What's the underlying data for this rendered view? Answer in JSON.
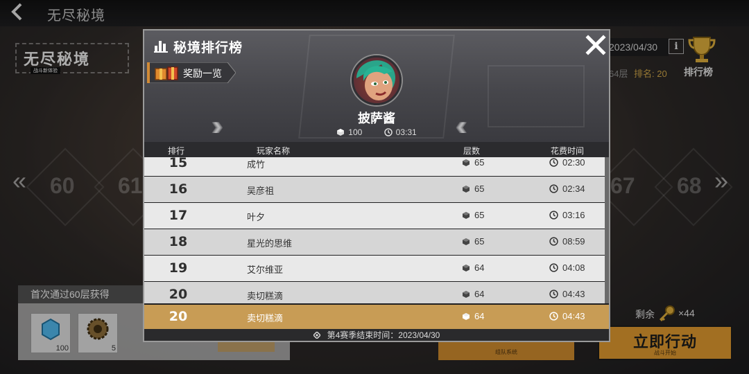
{
  "header": {
    "back_icon": "chevron-left-icon",
    "title": "无尽秘境"
  },
  "logo": {
    "text": "无尽秘境",
    "subtitle": "战斗新体验"
  },
  "stages": {
    "visible": [
      "60",
      "61",
      "67",
      "68"
    ]
  },
  "top_right": {
    "date_partial": "2023/04/30",
    "info_icon": "info-icon",
    "floor_partial": "64层",
    "rank_partial": "排名: 20",
    "ranking_button_label": "排行榜"
  },
  "first_clear": {
    "title": "首次通过60层获得",
    "items": [
      {
        "icon": "crystal-icon",
        "count": "100"
      },
      {
        "icon": "gear-token-icon",
        "count": "5"
      }
    ]
  },
  "bottom_right": {
    "remaining_label": "剩余",
    "key_count": "×44",
    "team_button_sub": "组队系统",
    "action_button_label": "立即行动",
    "action_button_sub": "战斗开始"
  },
  "modal": {
    "title": "秘境排行榜",
    "close_icon": "close-icon",
    "reward_list_label": "奖励一览",
    "player": {
      "name": "披萨酱",
      "floor": "100",
      "time": "03:31"
    },
    "columns": {
      "rank": "排行",
      "name": "玩家名称",
      "floor": "层数",
      "time": "花费时间"
    },
    "rows": [
      {
        "rank": "15",
        "name": "成竹",
        "floor": "65",
        "time": "02:30"
      },
      {
        "rank": "16",
        "name": "吴彦祖",
        "floor": "65",
        "time": "02:34"
      },
      {
        "rank": "17",
        "name": "叶夕",
        "floor": "65",
        "time": "03:16"
      },
      {
        "rank": "18",
        "name": "星光的思维",
        "floor": "65",
        "time": "08:59"
      },
      {
        "rank": "19",
        "name": "艾尔维亚",
        "floor": "64",
        "time": "04:08"
      },
      {
        "rank": "20",
        "name": "卖切糕滴",
        "floor": "64",
        "time": "04:43"
      }
    ],
    "my_row": {
      "rank": "20",
      "name": "卖切糕滴",
      "floor": "64",
      "time": "04:43"
    },
    "season_end": "第4赛季结束时间：2023/04/30"
  },
  "colors": {
    "accent_gold": "#c89c55",
    "action_orange": "#d8952e"
  }
}
